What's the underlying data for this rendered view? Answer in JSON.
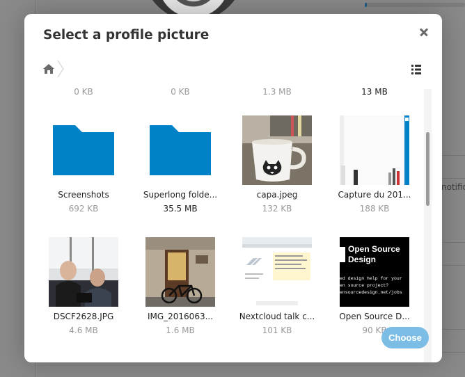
{
  "dialog": {
    "title": "Select a profile picture",
    "choose_label": "Choose"
  },
  "background": {
    "notification_fragment": "notifica",
    "progress_fraction": 0.02
  },
  "partial_row_sizes": [
    "0 KB",
    "0 KB",
    "1.3 MB",
    "13 MB"
  ],
  "files": [
    {
      "name": "Screenshots",
      "size": "692 KB",
      "type": "folder"
    },
    {
      "name": "Superlong folde...",
      "size": "35.5 MB",
      "type": "folder"
    },
    {
      "name": "capa.jpeg",
      "size": "132 KB",
      "type": "image"
    },
    {
      "name": "Capture du 201...",
      "size": "188 KB",
      "type": "image"
    },
    {
      "name": "DSCF2628.JPG",
      "size": "4.6 MB",
      "type": "image"
    },
    {
      "name": "IMG_2016063...",
      "size": "1.6 MB",
      "type": "image"
    },
    {
      "name": "Nextcloud talk c...",
      "size": "101 KB",
      "type": "image"
    },
    {
      "name": "Open Source D...",
      "size": "90 KB",
      "type": "image"
    }
  ],
  "thumbnail_texts": {
    "open_source_design": [
      "Open Source",
      "Design",
      "ed design help for your",
      "en source project?",
      "ensourcedesign.net/jobs"
    ]
  },
  "colors": {
    "folder": "#0082c9",
    "choose_button": "#7cbde5",
    "accent": "#0082c9"
  },
  "icons": [
    "home-icon",
    "breadcrumb-separator-icon",
    "close-icon",
    "list-view-icon",
    "folder-icon"
  ]
}
